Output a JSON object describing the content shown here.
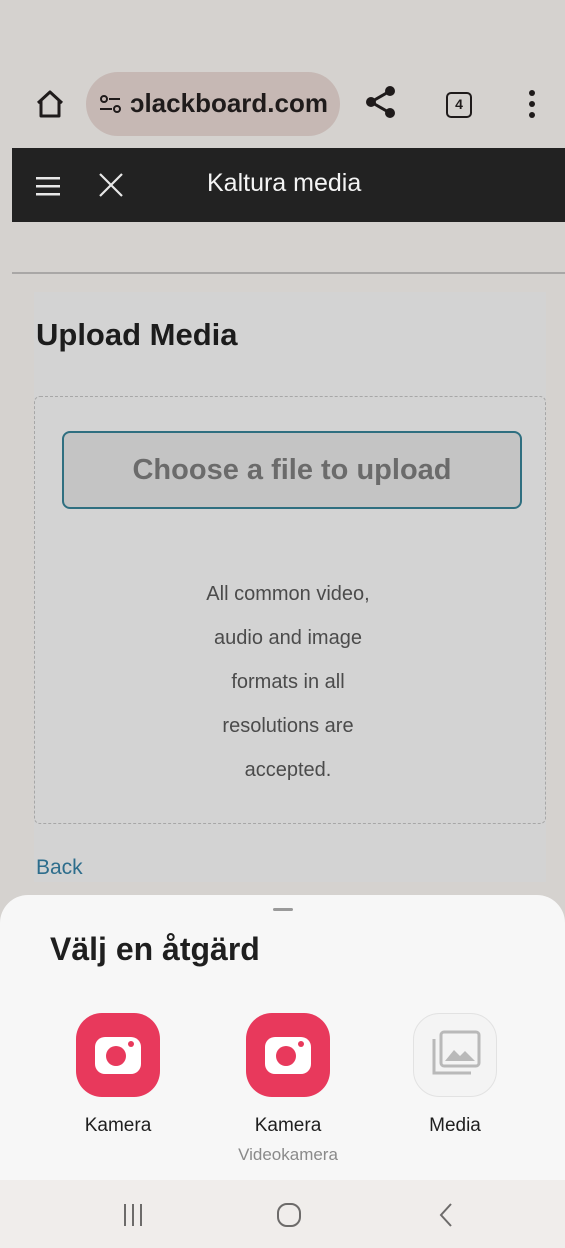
{
  "browser": {
    "url": "ɔlackboard.com",
    "tab_count": "4",
    "icons": [
      "home-icon",
      "tune-icon",
      "share-icon",
      "tabs-icon",
      "more-vert-icon"
    ]
  },
  "kaltura": {
    "title": "Kaltura media",
    "icons": [
      "hamburger-icon",
      "close-icon"
    ]
  },
  "upload": {
    "title": "Upload Media",
    "choose_button": "Choose a file to upload",
    "formats_lines": [
      "All common video,",
      "audio and image",
      "formats in all",
      "resolutions are",
      "accepted."
    ],
    "back_link": "Back"
  },
  "sheet": {
    "title": "Välj en åtgärd",
    "apps": [
      {
        "label": "Kamera",
        "subtitle": "",
        "icon": "camera-icon",
        "color": "#e8395c"
      },
      {
        "label": "Kamera",
        "subtitle": "Videokamera",
        "icon": "camera-icon",
        "color": "#e8395c"
      },
      {
        "label": "Media",
        "subtitle": "",
        "icon": "gallery-icon",
        "color": "#f2f2f2"
      }
    ]
  },
  "navbar": {
    "icons": [
      "recents-icon",
      "home-circle-icon",
      "back-icon"
    ]
  }
}
